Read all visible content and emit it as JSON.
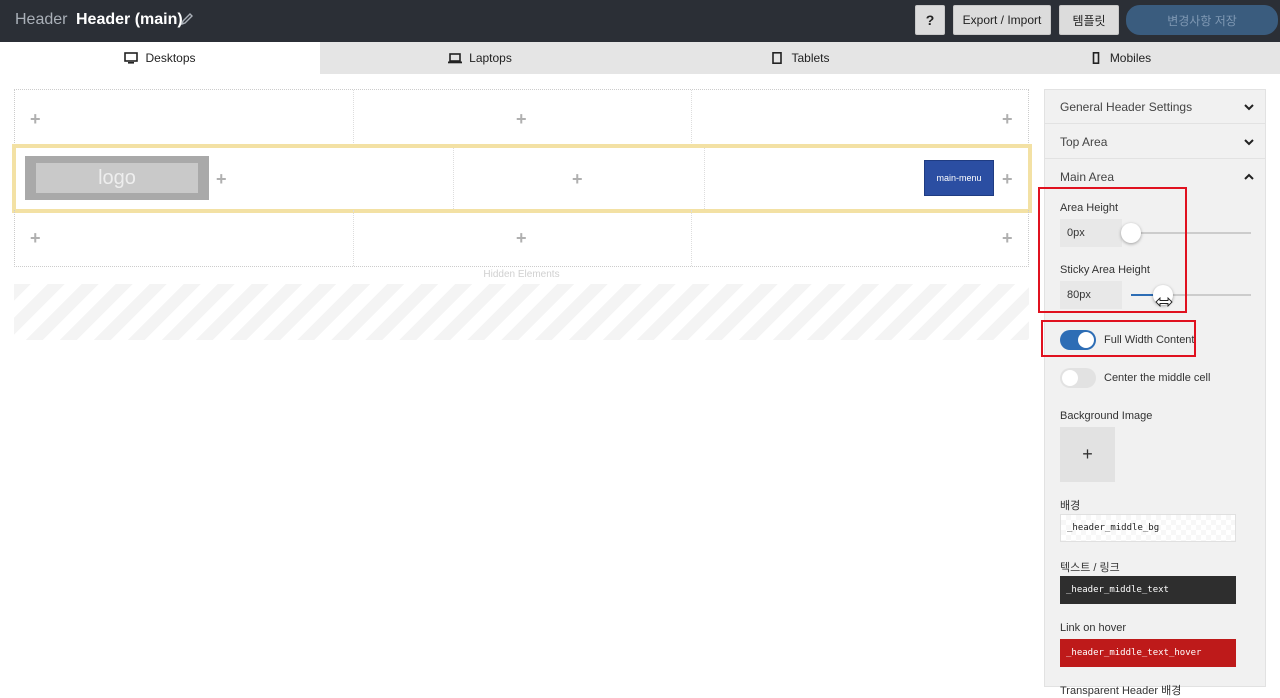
{
  "topbar": {
    "section_label": "Header",
    "header_name": "Header (main)",
    "edit_icon": "pencil-icon",
    "help_label": "?",
    "export_label": "Export / Import",
    "template_label": "템플릿",
    "save_label": "변경사항 저장"
  },
  "tabs": [
    {
      "label": "Desktops",
      "icon": "desktop-icon",
      "active": true
    },
    {
      "label": "Laptops",
      "icon": "laptop-icon",
      "active": false
    },
    {
      "label": "Tablets",
      "icon": "tablet-icon",
      "active": false
    },
    {
      "label": "Mobiles",
      "icon": "mobile-icon",
      "active": false
    }
  ],
  "canvas": {
    "add_symbol": "+",
    "logo_label": "logo",
    "menu_label": "main-menu",
    "hidden_label": "Hidden Elements"
  },
  "panel": {
    "sections": [
      {
        "label": "General Header Settings",
        "expanded": false
      },
      {
        "label": "Top Area",
        "expanded": false
      },
      {
        "label": "Main Area",
        "expanded": true
      }
    ],
    "area_height": {
      "label": "Area Height",
      "value": "0px",
      "slider_fraction": 0.0
    },
    "sticky_area_height": {
      "label": "Sticky Area Height",
      "value": "80px",
      "slider_fraction": 0.27
    },
    "full_width": {
      "label": "Full Width Content",
      "on": true
    },
    "center_middle": {
      "label": "Center the middle cell",
      "on": false
    },
    "background_image": {
      "label": "Background Image",
      "add_symbol": "+"
    },
    "bg_color": {
      "label": "배경",
      "value": "_header_middle_bg"
    },
    "text_color": {
      "label": "텍스트 / 링크",
      "value": "_header_middle_text",
      "color": "#2e2e2e"
    },
    "hover_color": {
      "label": "Link on hover",
      "value": "_header_middle_text_hover",
      "color": "#be1a1a"
    },
    "next_label": "Transparent Header 배경"
  },
  "colors": {
    "accent": "#2d6db5",
    "highlight": "#e0111f",
    "main_row_border": "#f3e1a4"
  }
}
